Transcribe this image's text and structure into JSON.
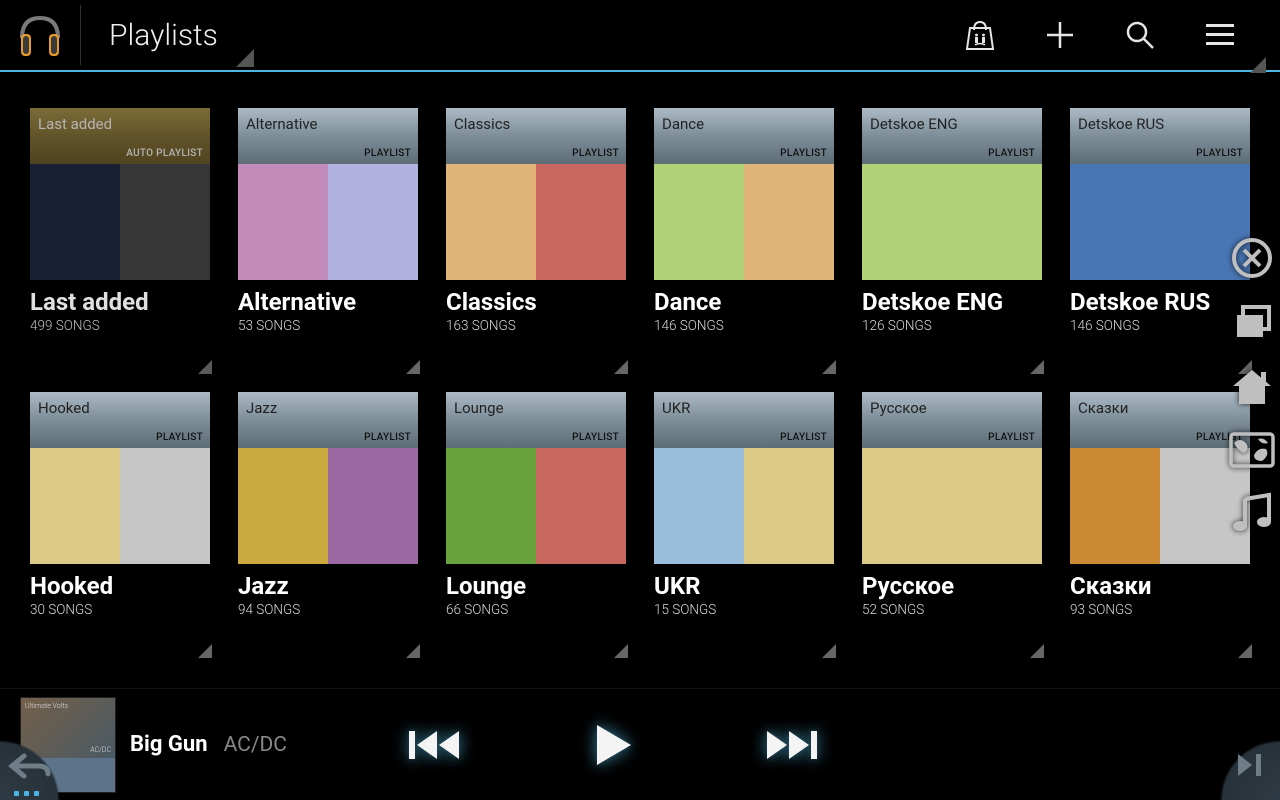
{
  "header": {
    "title": "Playlists"
  },
  "labels": {
    "auto_playlist": "AUTO PLAYLIST",
    "playlist": "PLAYLIST",
    "songs_suffix": "SONGS"
  },
  "playlists": [
    {
      "name": "Last added",
      "display": "Last added",
      "count": 499,
      "auto": true,
      "art": [
        "#1a263a",
        "#3d3d3d"
      ]
    },
    {
      "name": "Alternative",
      "display": "Alternative",
      "count": 53,
      "auto": false,
      "art": [
        "#c28bb9",
        "#b1b2e0"
      ]
    },
    {
      "name": "Classics",
      "display": "Classics",
      "count": 163,
      "auto": false,
      "art": [
        "#e0b477",
        "#c86760"
      ]
    },
    {
      "name": "Dance",
      "display": "Dance",
      "count": 146,
      "auto": false,
      "art": [
        "#b1d177",
        "#e0b477"
      ]
    },
    {
      "name": "Detskoe ENG",
      "display": "Detskoe ENG",
      "count": 126,
      "auto": false,
      "art": [
        "#b1d177",
        "#b1d177"
      ]
    },
    {
      "name": "Detskoe RUS",
      "display": "Detskoe RUS",
      "count": 146,
      "auto": false,
      "art": [
        "#4876b4",
        "#4876b4"
      ]
    },
    {
      "name": "Hooked",
      "display": "Hooked",
      "count": 30,
      "auto": false,
      "art": [
        "#dcc986",
        "#c6c6c6"
      ]
    },
    {
      "name": "Jazz",
      "display": "Jazz",
      "count": 94,
      "auto": false,
      "art": [
        "#caa93f",
        "#9b6aa3"
      ]
    },
    {
      "name": "Lounge",
      "display": "Lounge",
      "count": 66,
      "auto": false,
      "art": [
        "#6aa33e",
        "#c86760"
      ]
    },
    {
      "name": "UKR",
      "display": "UKR",
      "count": 15,
      "auto": false,
      "art": [
        "#9bbedd",
        "#dcc986"
      ]
    },
    {
      "name": "Русское",
      "display": "Русское",
      "count": 52,
      "auto": false,
      "art": [
        "#dcc986",
        "#dcc986"
      ]
    },
    {
      "name": "Сказки",
      "display": "Сказки",
      "count": 93,
      "auto": false,
      "art": [
        "#cd8a34",
        "#c6c6c6"
      ]
    }
  ],
  "now_playing": {
    "track": "Big Gun",
    "artist": "AC/DC",
    "album": "Ultimate Volts",
    "album_artist": "AC/DC"
  }
}
